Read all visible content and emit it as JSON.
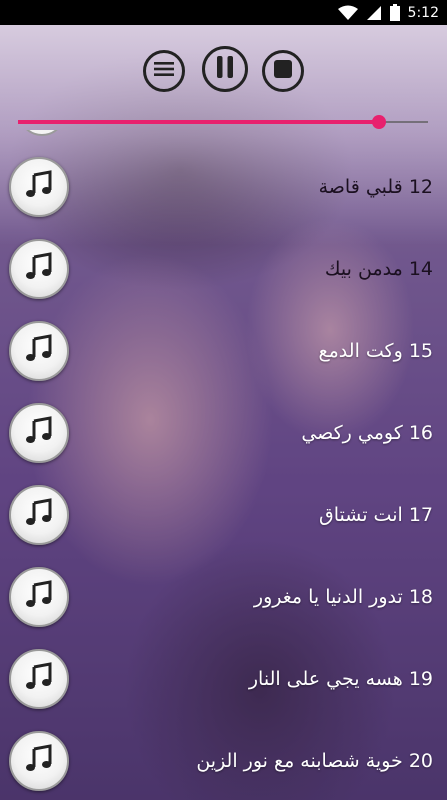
{
  "status_bar": {
    "time": "5:12",
    "icons": [
      "wifi-icon",
      "signal-icon",
      "battery-icon"
    ]
  },
  "player": {
    "controls": [
      "menu-icon",
      "pause-icon",
      "stop-icon"
    ],
    "progress_fraction": 0.88,
    "accent_color": "#e8216e"
  },
  "tracks": [
    {
      "label": "12  قلبي قاصة"
    },
    {
      "label": "14 مدمن بيك"
    },
    {
      "label": "15 وكت الدمع"
    },
    {
      "label": "16 كومي ركصي"
    },
    {
      "label": "17 انت تشتاق"
    },
    {
      "label": "18 تدور الدنيا يا مغرور"
    },
    {
      "label": "19 هسه يجي على النار"
    },
    {
      "label": "20 خوية شصابنه مع نور الزين"
    }
  ],
  "track_icon": "music-note-icon"
}
